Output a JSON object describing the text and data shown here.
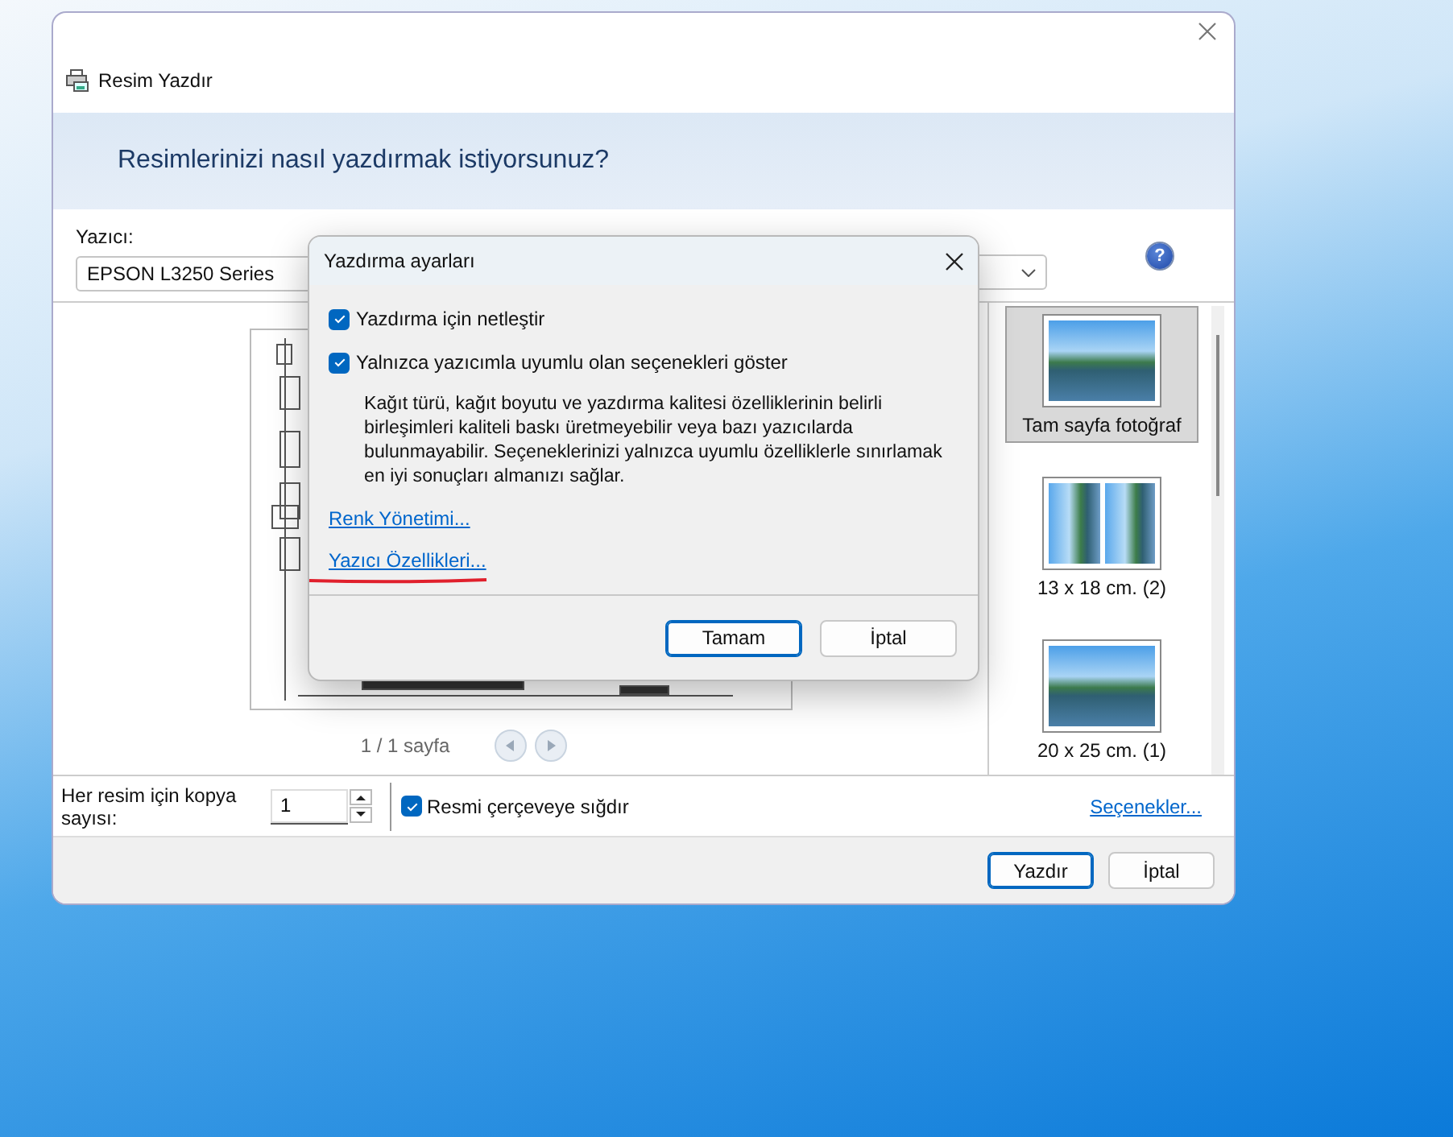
{
  "window": {
    "title": "Resim Yazdır",
    "heading": "Resimlerinizi nasıl yazdırmak istiyorsunuz?"
  },
  "printer": {
    "label": "Yazıcı:",
    "value": "EPSON L3250 Series"
  },
  "help": "?",
  "preview": {
    "page_count": "1 / 1 sayfa"
  },
  "layouts": [
    {
      "label": "Tam sayfa fotoğraf",
      "selected": true,
      "kind": "single"
    },
    {
      "label": "13 x 18 cm. (2)",
      "selected": false,
      "kind": "double"
    },
    {
      "label": "20 x 25 cm. (1)",
      "selected": false,
      "kind": "single"
    }
  ],
  "copies": {
    "label": "Her resim için kopya sayısı:",
    "value": "1"
  },
  "fit_to_frame": {
    "label": "Resmi çerçeveye sığdır",
    "checked": true
  },
  "options_link": "Seçenekler...",
  "buttons": [
    {
      "label": "Yazdır",
      "default": true
    },
    {
      "label": "İptal",
      "default": false
    }
  ],
  "dialog": {
    "title": "Yazdırma ayarları",
    "options": [
      {
        "label": "Yazdırma için netleştir",
        "checked": true
      },
      {
        "label": "Yalnızca yazıcımla uyumlu olan seçenekleri göster",
        "checked": true
      }
    ],
    "description": "Kağıt türü, kağıt boyutu ve yazdırma kalitesi özelliklerinin belirli birleşimleri kaliteli baskı üretmeyebilir veya bazı yazıcılarda bulunmayabilir. Seçeneklerinizi yalnızca uyumlu özelliklerle sınırlamak en iyi sonuçları almanızı sağlar.",
    "links": [
      "Renk Yönetimi...",
      "Yazıcı Özellikleri..."
    ],
    "buttons": [
      {
        "label": "Tamam",
        "default": true
      },
      {
        "label": "İptal",
        "default": false
      }
    ]
  }
}
